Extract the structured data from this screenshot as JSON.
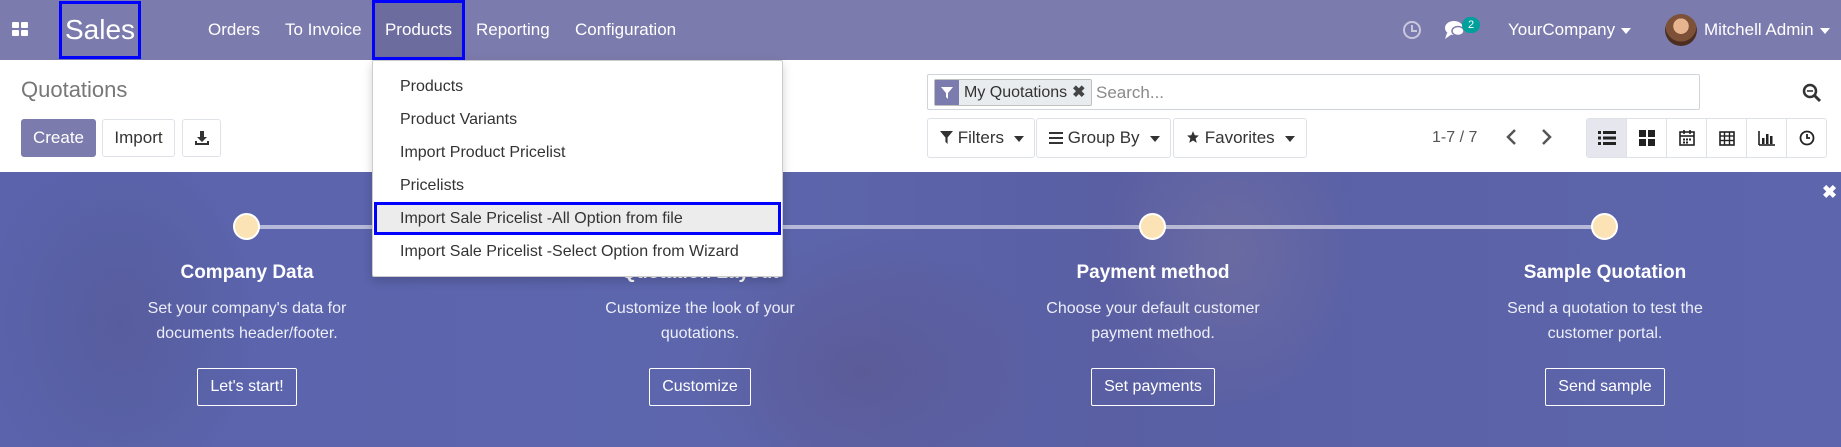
{
  "navbar": {
    "app_name": "Sales",
    "menu": [
      "Orders",
      "To Invoice",
      "Products",
      "Reporting",
      "Configuration"
    ],
    "messages_badge": "2",
    "company": "YourCompany",
    "user": "Mitchell Admin",
    "colors": {
      "navbar_bg": "#7c7bad",
      "highlight_border": "#0000ff",
      "badge_bg": "#00a09d"
    }
  },
  "products_menu": {
    "items": [
      "Products",
      "Product Variants",
      "Import Product Pricelist",
      "Pricelists",
      "Import Sale Pricelist -All Option from file",
      "Import Sale Pricelist -Select Option from Wizard"
    ],
    "highlighted_index": 4
  },
  "control_panel": {
    "title": "Quotations",
    "create_label": "Create",
    "import_label": "Import",
    "search": {
      "facet_label": "My Quotations",
      "placeholder": "Search...",
      "value": ""
    },
    "filters_label": "Filters",
    "groupby_label": "Group By",
    "favorites_label": "Favorites",
    "pager": "1-7 / 7",
    "views": [
      "list-icon",
      "kanban-icon",
      "calendar-icon",
      "pivot-icon",
      "graph-icon",
      "activity-icon"
    ],
    "active_view": "list-icon"
  },
  "onboarding": {
    "steps": [
      {
        "title": "Company Data",
        "desc_1": "Set your company's data for",
        "desc_2": "documents header/footer.",
        "button": "Let's start!"
      },
      {
        "title": "Quotation Layout",
        "desc_1": "Customize the look of your",
        "desc_2": "quotations.",
        "button": "Customize"
      },
      {
        "title": "Payment method",
        "desc_1": "Choose your default customer",
        "desc_2": "payment method.",
        "button": "Set payments"
      },
      {
        "title": "Sample Quotation",
        "desc_1": "Send a quotation to test the",
        "desc_2": "customer portal.",
        "button": "Send sample"
      }
    ],
    "dot_color": "#fbe3b6"
  }
}
